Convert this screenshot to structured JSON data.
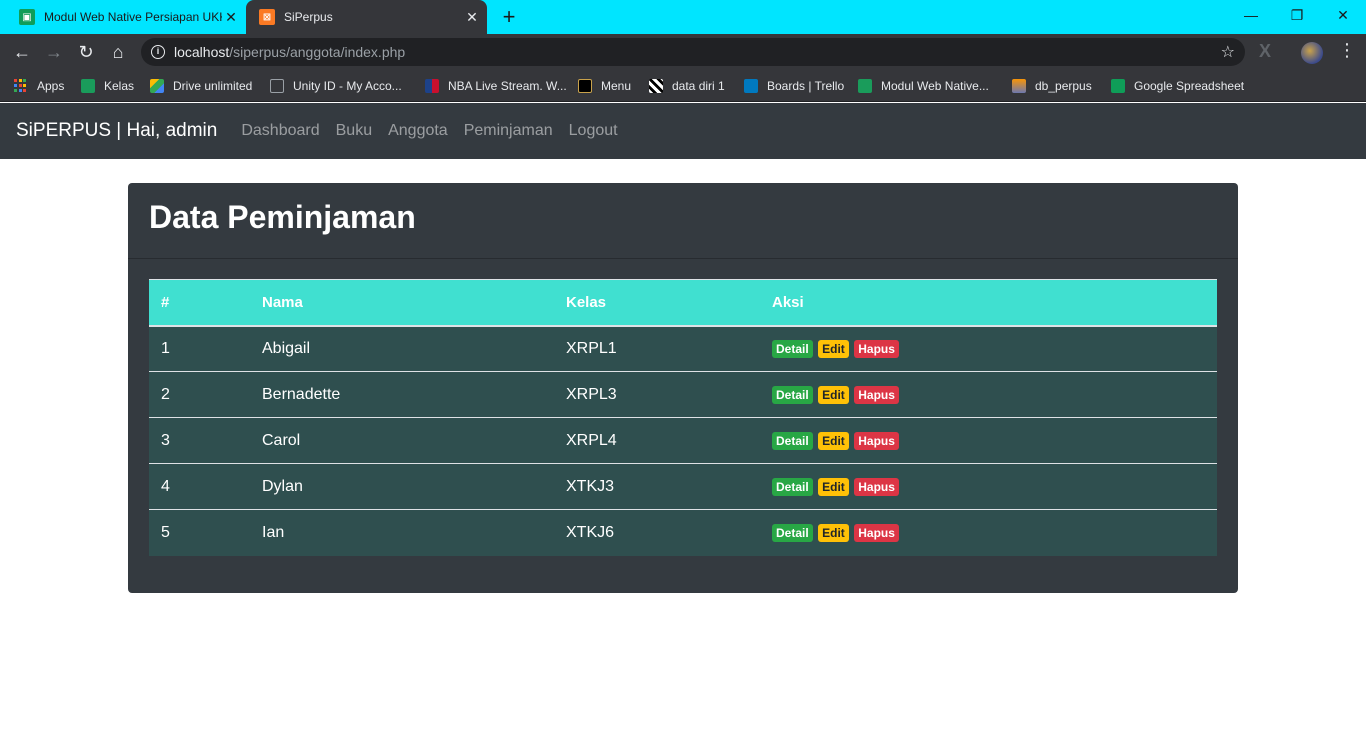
{
  "browser": {
    "tabs": [
      {
        "title": "Modul Web Native Persiapan UKK",
        "active": false,
        "icon": "google-classroom-icon"
      },
      {
        "title": "SiPerpus",
        "active": true,
        "icon": "xampp-icon"
      }
    ],
    "url_host": "localhost",
    "url_path": "/siperpus/anggota/index.php",
    "bookmarks": [
      {
        "label": "Apps",
        "icon": "apps-grid-icon"
      },
      {
        "label": "Kelas",
        "icon": "classroom-icon"
      },
      {
        "label": "Drive unlimited",
        "icon": "drive-icon"
      },
      {
        "label": "Unity ID - My Acco...",
        "icon": "unity-icon"
      },
      {
        "label": "NBA Live Stream. W...",
        "icon": "nba-icon"
      },
      {
        "label": "Menu",
        "icon": "menu-icon"
      },
      {
        "label": "data diri 1",
        "icon": "data-icon"
      },
      {
        "label": "Boards | Trello",
        "icon": "trello-icon"
      },
      {
        "label": "Modul Web Native...",
        "icon": "classroom-icon"
      },
      {
        "label": "db_perpus",
        "icon": "pma-icon"
      },
      {
        "label": "Google Spreadsheet",
        "icon": "sheets-icon"
      }
    ]
  },
  "navbar": {
    "brand": "SiPERPUS | Hai, admin",
    "links": [
      "Dashboard",
      "Buku",
      "Anggota",
      "Peminjaman",
      "Logout"
    ]
  },
  "card": {
    "title": "Data Peminjaman",
    "columns": [
      "#",
      "Nama",
      "Kelas",
      "Aksi"
    ],
    "rows": [
      {
        "no": "1",
        "nama": "Abigail",
        "kelas": "XRPL1"
      },
      {
        "no": "2",
        "nama": "Bernadette",
        "kelas": "XRPL3"
      },
      {
        "no": "3",
        "nama": "Carol",
        "kelas": "XRPL4"
      },
      {
        "no": "4",
        "nama": "Dylan",
        "kelas": "XTKJ3"
      },
      {
        "no": "5",
        "nama": "Ian",
        "kelas": "XTKJ6"
      }
    ],
    "actions": {
      "detail": "Detail",
      "edit": "Edit",
      "hapus": "Hapus"
    }
  },
  "colors": {
    "tabstrip": "#00e5ff",
    "navbar": "#343a40",
    "table_header": "#40e0d0",
    "table_row": "#2f4f4f",
    "detail": "#28a745",
    "edit": "#ffc107",
    "hapus": "#dc3545"
  }
}
